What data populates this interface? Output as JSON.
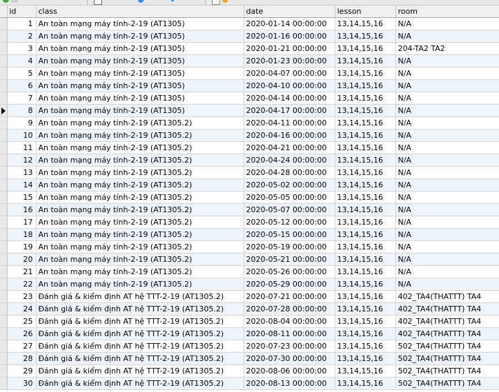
{
  "columns": [
    "id",
    "class",
    "date",
    "lesson",
    "room"
  ],
  "current_row_id": "8",
  "rows": [
    {
      "id": "1",
      "class": "An toàn mạng máy tính-2-19 (AT1305)",
      "date": "2020-01-14 00:00:00",
      "lesson": "13,14,15,16",
      "room": "N/A"
    },
    {
      "id": "2",
      "class": "An toàn mạng máy tính-2-19 (AT1305)",
      "date": "2020-01-16 00:00:00",
      "lesson": "13,14,15,16",
      "room": "N/A"
    },
    {
      "id": "3",
      "class": "An toàn mạng máy tính-2-19 (AT1305)",
      "date": "2020-01-21 00:00:00",
      "lesson": "13,14,15,16",
      "room": "204-TA2 TA2"
    },
    {
      "id": "4",
      "class": "An toàn mạng máy tính-2-19 (AT1305)",
      "date": "2020-01-23 00:00:00",
      "lesson": "13,14,15,16",
      "room": "N/A"
    },
    {
      "id": "5",
      "class": "An toàn mạng máy tính-2-19 (AT1305)",
      "date": "2020-04-07 00:00:00",
      "lesson": "13,14,15,16",
      "room": "N/A"
    },
    {
      "id": "6",
      "class": "An toàn mạng máy tính-2-19 (AT1305)",
      "date": "2020-04-10 00:00:00",
      "lesson": "13,14,15,16",
      "room": "N/A"
    },
    {
      "id": "7",
      "class": "An toàn mạng máy tính-2-19 (AT1305)",
      "date": "2020-04-14 00:00:00",
      "lesson": "13,14,15,16",
      "room": "N/A"
    },
    {
      "id": "8",
      "class": "An toàn mạng máy tính-2-19 (AT1305)",
      "date": "2020-04-17 00:00:00",
      "lesson": "13,14,15,16",
      "room": " N/A"
    },
    {
      "id": "9",
      "class": "An toàn mạng máy tính-2-19 (AT1305.2)",
      "date": "2020-04-11 00:00:00",
      "lesson": "13,14,15,16",
      "room": "N/A"
    },
    {
      "id": "10",
      "class": "An toàn mạng máy tính-2-19 (AT1305.2)",
      "date": "2020-04-16 00:00:00",
      "lesson": "13,14,15,16",
      "room": "N/A"
    },
    {
      "id": "11",
      "class": "An toàn mạng máy tính-2-19 (AT1305.2)",
      "date": "2020-04-21 00:00:00",
      "lesson": "13,14,15,16",
      "room": "N/A"
    },
    {
      "id": "12",
      "class": "An toàn mạng máy tính-2-19 (AT1305.2)",
      "date": "2020-04-24 00:00:00",
      "lesson": "13,14,15,16",
      "room": "N/A"
    },
    {
      "id": "13",
      "class": "An toàn mạng máy tính-2-19 (AT1305.2)",
      "date": "2020-04-28 00:00:00",
      "lesson": "13,14,15,16",
      "room": "N/A"
    },
    {
      "id": "14",
      "class": "An toàn mạng máy tính-2-19 (AT1305.2)",
      "date": "2020-05-02 00:00:00",
      "lesson": "13,14,15,16",
      "room": "N/A"
    },
    {
      "id": "15",
      "class": "An toàn mạng máy tính-2-19 (AT1305.2)",
      "date": "2020-05-05 00:00:00",
      "lesson": "13,14,15,16",
      "room": "N/A"
    },
    {
      "id": "16",
      "class": "An toàn mạng máy tính-2-19 (AT1305.2)",
      "date": "2020-05-07 00:00:00",
      "lesson": "13,14,15,16",
      "room": "N/A"
    },
    {
      "id": "17",
      "class": "An toàn mạng máy tính-2-19 (AT1305.2)",
      "date": "2020-05-12 00:00:00",
      "lesson": "13,14,15,16",
      "room": "N/A"
    },
    {
      "id": "18",
      "class": "An toàn mạng máy tính-2-19 (AT1305.2)",
      "date": "2020-05-15 00:00:00",
      "lesson": "13,14,15,16",
      "room": "N/A"
    },
    {
      "id": "19",
      "class": "An toàn mạng máy tính-2-19 (AT1305.2)",
      "date": "2020-05-19 00:00:00",
      "lesson": "13,14,15,16",
      "room": "N/A"
    },
    {
      "id": "20",
      "class": "An toàn mạng máy tính-2-19 (AT1305.2)",
      "date": "2020-05-21 00:00:00",
      "lesson": "13,14,15,16",
      "room": "N/A"
    },
    {
      "id": "21",
      "class": "An toàn mạng máy tính-2-19 (AT1305.2)",
      "date": "2020-05-26 00:00:00",
      "lesson": "13,14,15,16",
      "room": "N/A"
    },
    {
      "id": "22",
      "class": "An toàn mạng máy tính-2-19 (AT1305.2)",
      "date": "2020-05-29 00:00:00",
      "lesson": "13,14,15,16",
      "room": "N/A"
    },
    {
      "id": "23",
      "class": "Đánh giá & kiểm định AT hệ TTT-2-19 (AT1305.2)",
      "date": "2020-07-21 00:00:00",
      "lesson": "13,14,15,16",
      "room": "402_TA4(THATTT) TA4"
    },
    {
      "id": "24",
      "class": "Đánh giá & kiểm định AT hệ TTT-2-19 (AT1305.2)",
      "date": "2020-07-28 00:00:00",
      "lesson": "13,14,15,16",
      "room": "402_TA4(THATTT) TA4"
    },
    {
      "id": "25",
      "class": "Đánh giá & kiểm định AT hệ TTT-2-19 (AT1305.2)",
      "date": "2020-08-04 00:00:00",
      "lesson": "13,14,15,16",
      "room": "402_TA4(THATTT) TA4"
    },
    {
      "id": "26",
      "class": "Đánh giá & kiểm định AT hệ TTT-2-19 (AT1305.2)",
      "date": "2020-08-11 00:00:00",
      "lesson": "13,14,15,16",
      "room": "402_TA4(THATTT) TA4"
    },
    {
      "id": "27",
      "class": "Đánh giá & kiểm định AT hệ TTT-2-19 (AT1305.2)",
      "date": "2020-07-23 00:00:00",
      "lesson": "13,14,15,16",
      "room": "502_TA4(THATTT) TA4"
    },
    {
      "id": "28",
      "class": "Đánh giá & kiểm định AT hệ TTT-2-19 (AT1305.2)",
      "date": "2020-07-30 00:00:00",
      "lesson": "13,14,15,16",
      "room": "502_TA4(THATTT) TA4"
    },
    {
      "id": "29",
      "class": "Đánh giá & kiểm định AT hệ TTT-2-19 (AT1305.2)",
      "date": "2020-08-06 00:00:00",
      "lesson": "13,14,15,16",
      "room": "502_TA4(THATTT) TA4"
    },
    {
      "id": "30",
      "class": "Đánh giá & kiểm định AT hệ TTT-2-19 (AT1305.2)",
      "date": "2020-08-13 00:00:00",
      "lesson": "13,14,15,16",
      "room": "502_TA4(THATTT) TA4"
    }
  ],
  "colors": {
    "row_alt": "#eef4fc",
    "header_bg": "#f0f0f0",
    "toolbar_bg": "#e9e9e9"
  }
}
